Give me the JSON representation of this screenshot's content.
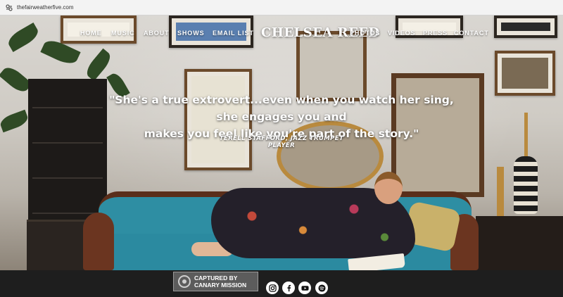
{
  "browser": {
    "url": "thefairweatherfive.com",
    "site_icon": "site-settings-icon"
  },
  "nav": {
    "left_items": [
      "HOME",
      "MUSIC",
      "ABOUT",
      "SHOWS",
      "EMAIL LIST"
    ],
    "brand": "CHELSEA REED",
    "right_items": [
      "PHOTOS",
      "VIDEOS",
      "PRESS",
      "CONTACT"
    ],
    "active": "HOME"
  },
  "hero": {
    "quote_line1": "\"She's a true extrovert...even when you watch her sing, she engages you and",
    "quote_line2": "makes you feel like you're part of the story.\"",
    "attribution": "TERELL STAFFORD, JAZZ TRUMPET PLAYER"
  },
  "footer": {
    "stamp_text_line1": "CAPTURED BY",
    "stamp_text_line2": "CANARY MISSION",
    "social_icons": [
      "instagram-icon",
      "facebook-icon",
      "youtube-icon",
      "spotify-icon"
    ]
  },
  "colors": {
    "sofa": "#2b8aa0",
    "footer_bg": "#1e1e1e",
    "nav_text": "#ffffff"
  }
}
